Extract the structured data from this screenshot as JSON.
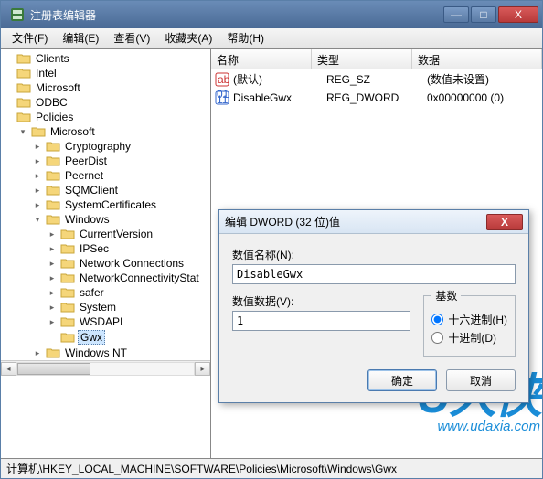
{
  "window": {
    "title": "注册表编辑器",
    "min": "—",
    "max": "□",
    "close": "X"
  },
  "menu": {
    "file": "文件(F)",
    "edit": "编辑(E)",
    "view": "查看(V)",
    "fav": "收藏夹(A)",
    "help": "帮助(H)"
  },
  "tree": {
    "items": [
      {
        "indent": 0,
        "exp": "",
        "label": "Clients"
      },
      {
        "indent": 0,
        "exp": "",
        "label": "Intel"
      },
      {
        "indent": 0,
        "exp": "",
        "label": "Microsoft"
      },
      {
        "indent": 0,
        "exp": "",
        "label": "ODBC"
      },
      {
        "indent": 0,
        "exp": "",
        "label": "Policies"
      },
      {
        "indent": 1,
        "exp": "▾",
        "label": "Microsoft"
      },
      {
        "indent": 2,
        "exp": "▸",
        "label": "Cryptography"
      },
      {
        "indent": 2,
        "exp": "▸",
        "label": "PeerDist"
      },
      {
        "indent": 2,
        "exp": "▸",
        "label": "Peernet"
      },
      {
        "indent": 2,
        "exp": "▸",
        "label": "SQMClient"
      },
      {
        "indent": 2,
        "exp": "▸",
        "label": "SystemCertificates"
      },
      {
        "indent": 2,
        "exp": "▾",
        "label": "Windows"
      },
      {
        "indent": 3,
        "exp": "▸",
        "label": "CurrentVersion"
      },
      {
        "indent": 3,
        "exp": "▸",
        "label": "IPSec"
      },
      {
        "indent": 3,
        "exp": "▸",
        "label": "Network Connections"
      },
      {
        "indent": 3,
        "exp": "▸",
        "label": "NetworkConnectivityStat"
      },
      {
        "indent": 3,
        "exp": "▸",
        "label": "safer"
      },
      {
        "indent": 3,
        "exp": "▸",
        "label": "System"
      },
      {
        "indent": 3,
        "exp": "▸",
        "label": "WSDAPI"
      },
      {
        "indent": 3,
        "exp": "",
        "label": "Gwx",
        "selected": true
      },
      {
        "indent": 2,
        "exp": "▸",
        "label": "Windows NT"
      }
    ]
  },
  "list": {
    "headers": {
      "name": "名称",
      "type": "类型",
      "data": "数据"
    },
    "rows": [
      {
        "icon": "str",
        "name": "(默认)",
        "type": "REG_SZ",
        "data": "(数值未设置)"
      },
      {
        "icon": "bin",
        "name": "DisableGwx",
        "type": "REG_DWORD",
        "data": "0x00000000 (0)"
      }
    ]
  },
  "dialog": {
    "title": "编辑 DWORD (32 位)值",
    "name_label": "数值名称(N):",
    "name_value": "DisableGwx",
    "data_label": "数值数据(V):",
    "data_value": "1",
    "base_legend": "基数",
    "hex_label": "十六进制(H)",
    "dec_label": "十进制(D)",
    "ok": "确定",
    "cancel": "取消"
  },
  "statusbar": "计算机\\HKEY_LOCAL_MACHINE\\SOFTWARE\\Policies\\Microsoft\\Windows\\Gwx",
  "watermark": {
    "big": "U大侠",
    "url": "www.udaxia.com"
  }
}
